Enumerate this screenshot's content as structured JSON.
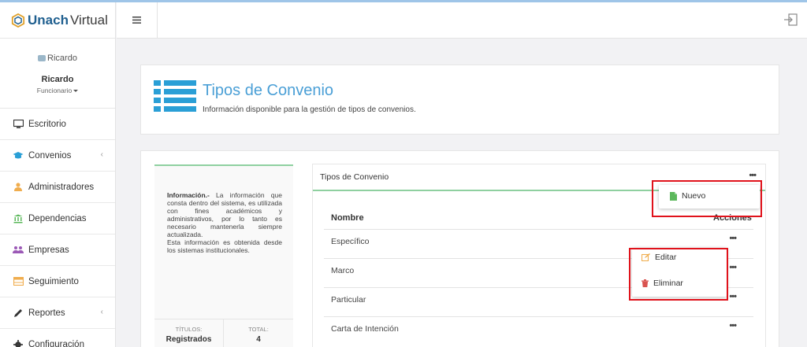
{
  "brand": {
    "strong": "Unach",
    "light": "Virtual"
  },
  "user": {
    "avatar_alt": "Ricardo",
    "name": "Ricardo",
    "role": "Funcionario"
  },
  "sidebar": {
    "items": [
      {
        "label": "Escritorio",
        "icon": "desktop-icon"
      },
      {
        "label": "Convenios",
        "icon": "graduation-cap-icon",
        "color": "#2a9fd6",
        "has_submenu": true
      },
      {
        "label": "Administradores",
        "icon": "user-icon",
        "color": "#f0ad4e"
      },
      {
        "label": "Dependencias",
        "icon": "institution-icon",
        "color": "#5cb85c"
      },
      {
        "label": "Empresas",
        "icon": "users-icon",
        "color": "#9b59b6"
      },
      {
        "label": "Seguimiento",
        "icon": "table-icon",
        "color": "#f0ad4e"
      },
      {
        "label": "Reportes",
        "icon": "pencil-icon",
        "has_submenu": true
      },
      {
        "label": "Configuración",
        "icon": "gear-icon"
      }
    ]
  },
  "header": {
    "title": "Tipos de Convenio",
    "subtitle": "Información disponible para la gestión de tipos de convenios."
  },
  "info": {
    "strong": "Información.-",
    "text": " La información que consta dentro del sistema, es utilizada con fines académicos y administrativos, por lo tanto es necesario mantenerla siempre actualizada.",
    "text2": "Esta información es obtenida desde los sistemas institucionales.",
    "stats": [
      {
        "label": "TÍTULOS:",
        "value": "Registrados"
      },
      {
        "label": "TOTAL:",
        "value": "4"
      }
    ]
  },
  "table": {
    "title": "Tipos de Convenio",
    "menu_glyph": "•••",
    "columns": {
      "name": "Nombre",
      "actions": "Acciones"
    },
    "rows": [
      "Específico",
      "Marco",
      "Particular",
      "Carta de Intención"
    ]
  },
  "dropdowns": {
    "header_menu": {
      "new_label": "Nuevo"
    },
    "row_menu": {
      "edit_label": "Editar",
      "delete_label": "Eliminar"
    }
  },
  "colors": {
    "accent": "#4a9fd6",
    "success": "#8fd0a0",
    "highlight": "#e0121b"
  }
}
